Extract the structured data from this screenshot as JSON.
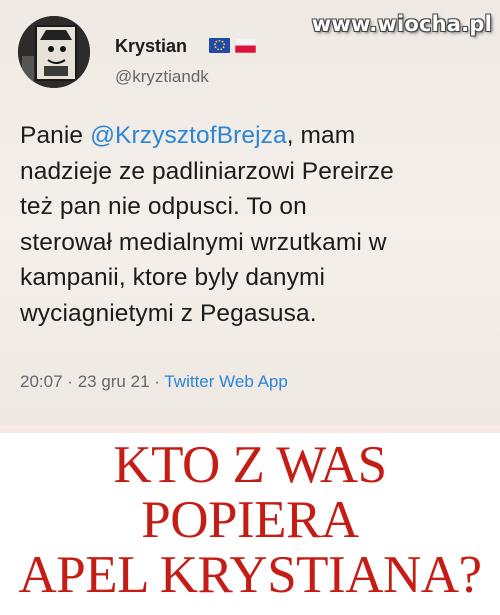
{
  "tweet": {
    "display_name": "Krystian",
    "handle": "@kryztiandk",
    "flags": [
      "eu-flag-icon",
      "poland-flag-icon"
    ],
    "body_prefix": "Panie ",
    "mention": "@KrzysztofBrejza",
    "body_lines": [
      ", mam",
      "nadzieje ze padliniarzowi Pereirze",
      "też pan nie odpusci. To on",
      "sterował medialnymi wrzutkami w",
      "kampanii, ktore byly danymi",
      "wyciagnietymi z Pegasusa."
    ],
    "time": "20:07",
    "separator": "·",
    "date": "23 gru 21",
    "app": "Twitter Web App"
  },
  "watermark": "www.wiocha.pl",
  "caption": {
    "lines": [
      "KTO Z WAS",
      "POPIERA",
      "APEL KRYSTIANA?"
    ],
    "color": "#c51d16"
  },
  "colors": {
    "link": "#2a86d6",
    "text": "#1c1c1c",
    "muted": "#63686e"
  }
}
